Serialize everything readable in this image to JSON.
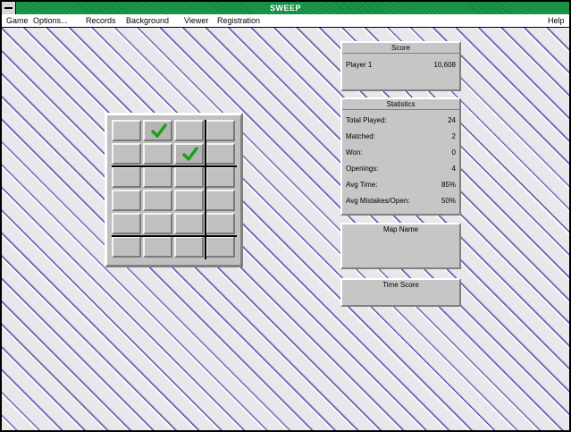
{
  "window": {
    "title": "SWEEP"
  },
  "menu": {
    "items": [
      "Game",
      "Options...",
      "Records",
      "Background",
      "Viewer",
      "Registration"
    ],
    "help": "Help"
  },
  "score_panel": {
    "header": "Score",
    "player_label": "Player 1",
    "player_value": "10,608"
  },
  "stats_panel": {
    "header": "Statistics",
    "rows": [
      {
        "label": "Total Played:",
        "value": "24"
      },
      {
        "label": "Matched:",
        "value": "2"
      },
      {
        "label": "Won:",
        "value": "0"
      },
      {
        "label": "Openings:",
        "value": "4"
      },
      {
        "label": "Avg Time:",
        "value": "85%"
      },
      {
        "label": "Avg Mistakes/Open:",
        "value": "50%"
      }
    ]
  },
  "map_panel": {
    "header": "Map Name"
  },
  "time_panel": {
    "header": "Time Score"
  },
  "board": {
    "cols": 4,
    "rows": 6,
    "marked_cells": [
      [
        0,
        1
      ],
      [
        1,
        2
      ]
    ],
    "icon": "checkmark-icon",
    "check_color": "#1aa01a"
  },
  "colors": {
    "titlebar": "#0a8a3a",
    "stripe": "#4d4da8"
  }
}
